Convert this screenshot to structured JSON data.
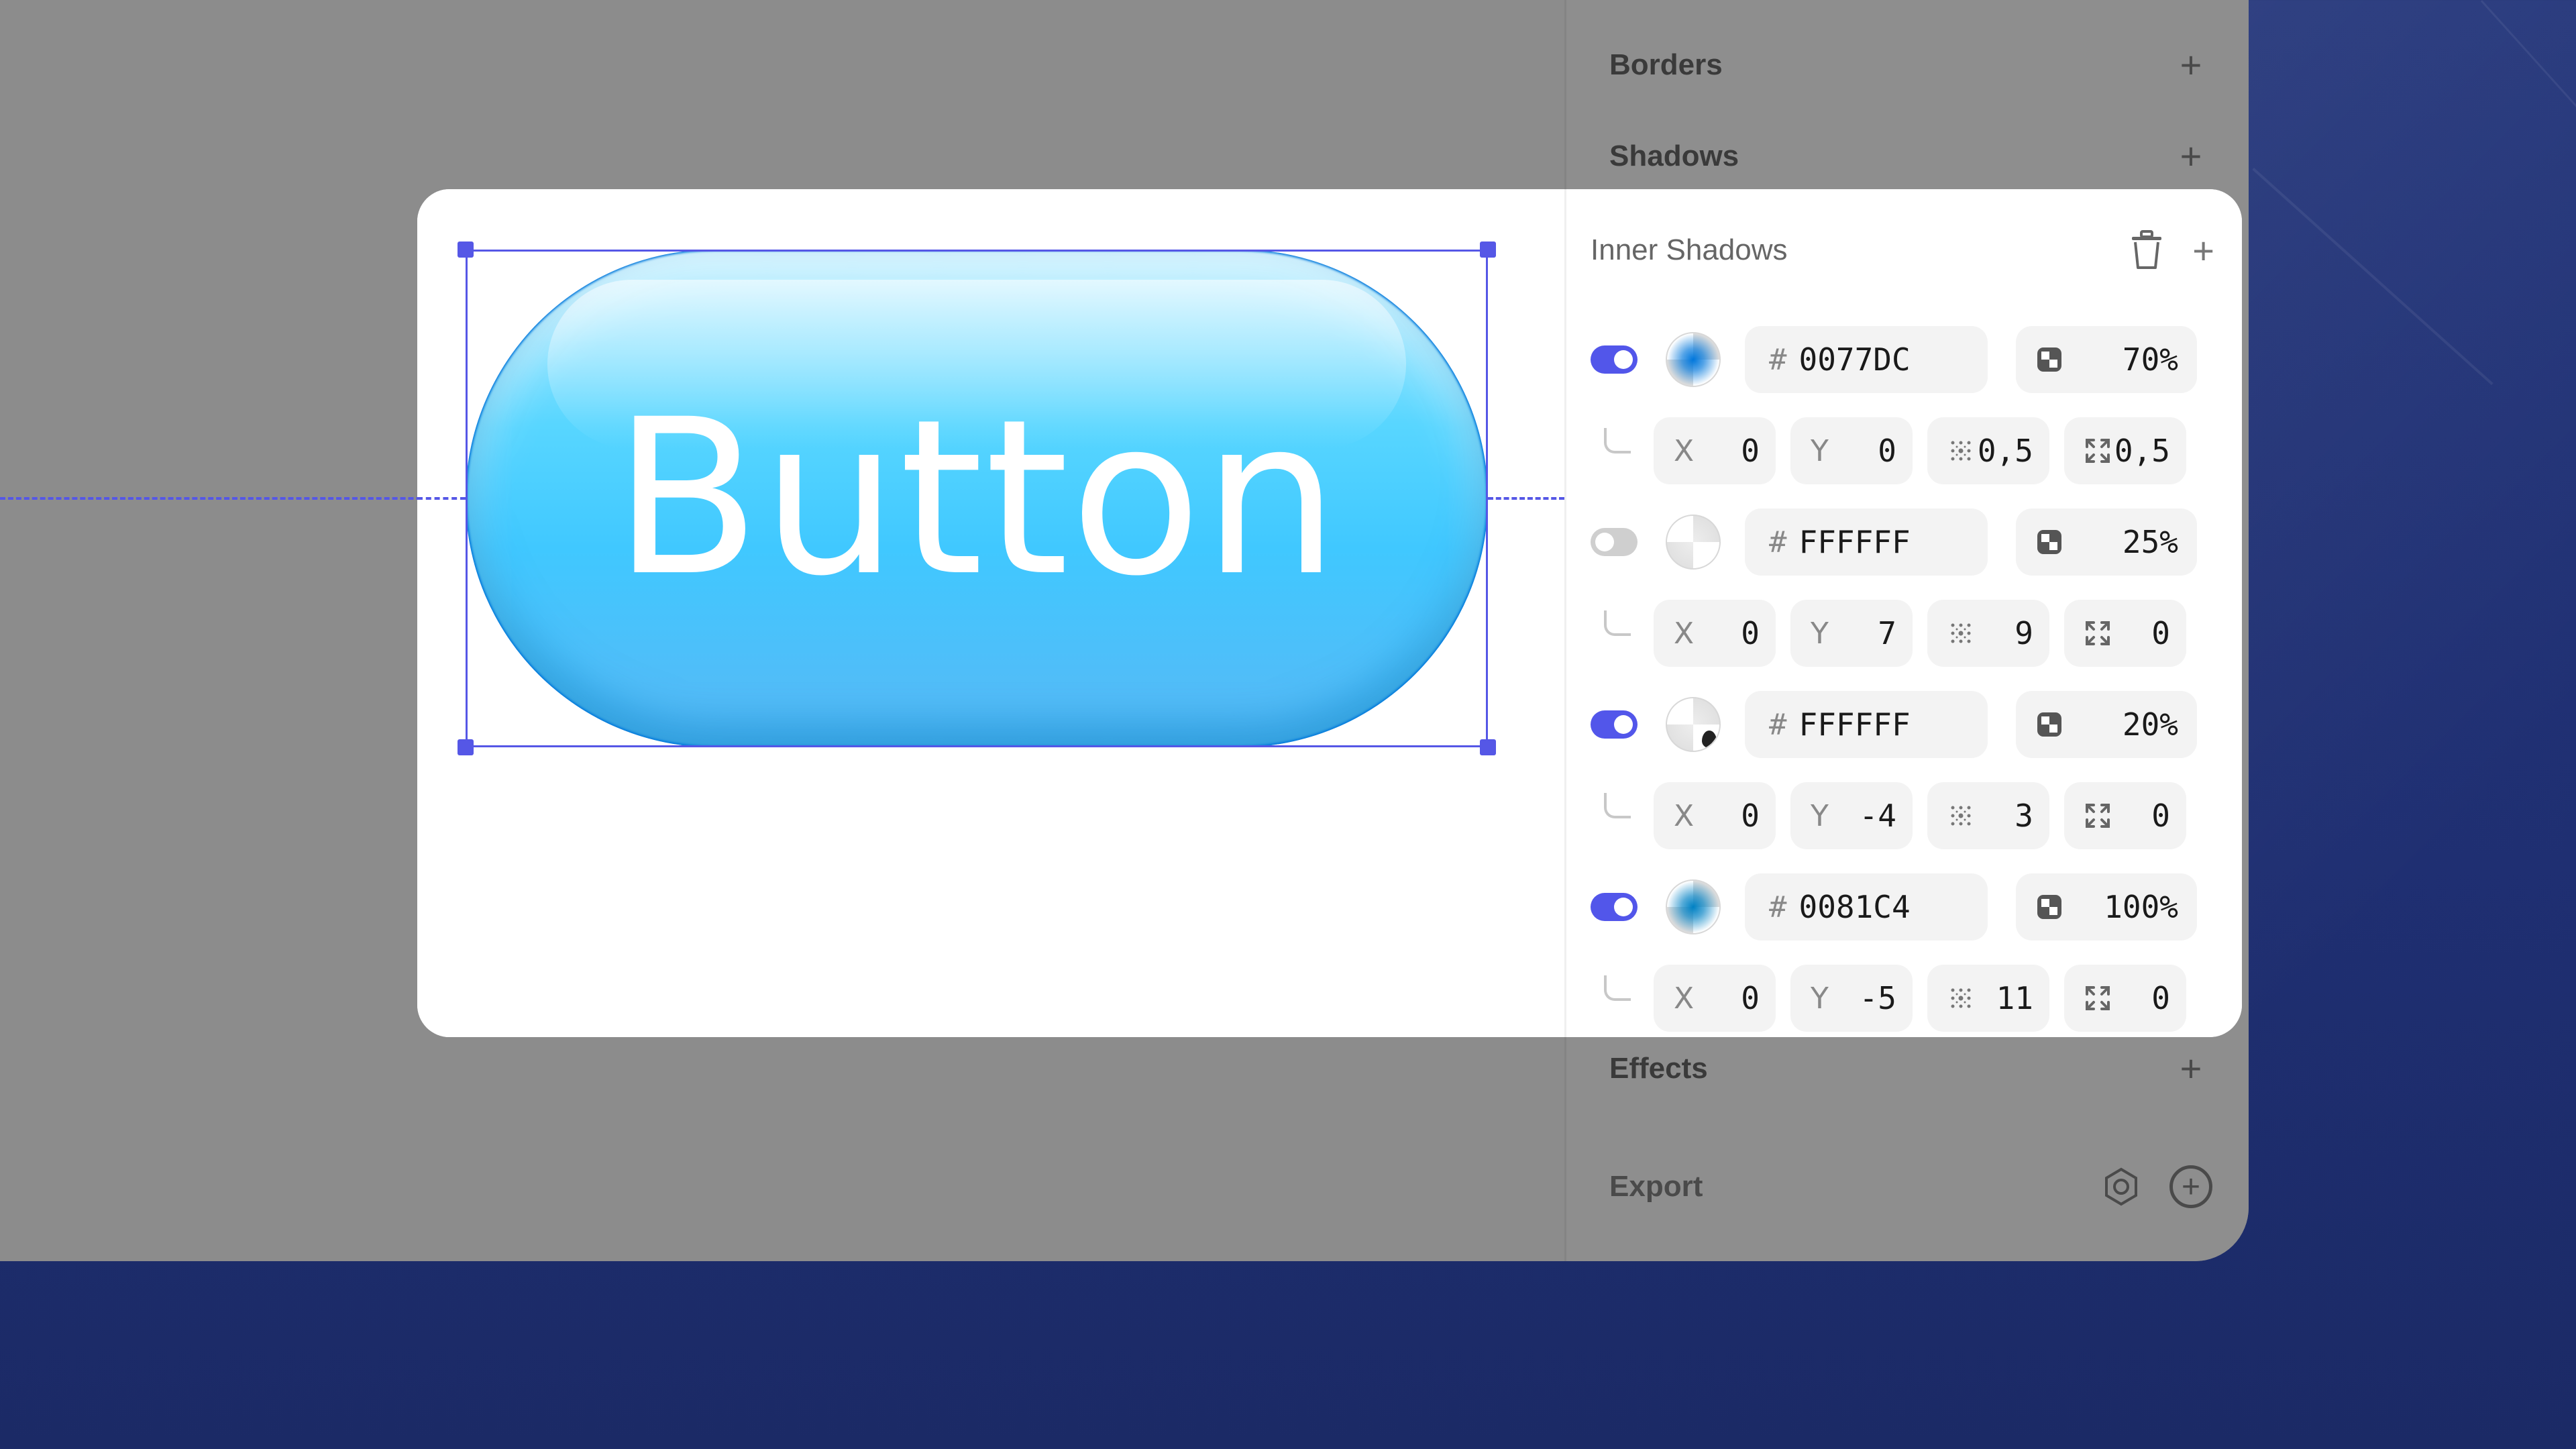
{
  "inspector": {
    "borders_label": "Borders",
    "shadows_label": "Shadows",
    "effects_label": "Effects",
    "export_label": "Export"
  },
  "canvas": {
    "button_text": "Button"
  },
  "inner_shadows": {
    "title": "Inner Shadows",
    "items": [
      {
        "enabled": true,
        "hex": "0077DC",
        "opacity": "70%",
        "x": "0",
        "y": "0",
        "blur": "0,5",
        "spread": "0,5",
        "tint": "#0077DC"
      },
      {
        "enabled": false,
        "hex": "FFFFFF",
        "opacity": "25%",
        "x": "0",
        "y": "7",
        "blur": "9",
        "spread": "0",
        "tint": "#FFFFFF"
      },
      {
        "enabled": true,
        "hex": "FFFFFF",
        "opacity": "20%",
        "x": "0",
        "y": "-4",
        "blur": "3",
        "spread": "0",
        "tint": "#FFFFFF"
      },
      {
        "enabled": true,
        "hex": "0081C4",
        "opacity": "100%",
        "x": "0",
        "y": "-5",
        "blur": "11",
        "spread": "0",
        "tint": "#0081C4"
      }
    ],
    "x_label": "X",
    "y_label": "Y",
    "hash": "#"
  },
  "colors": {
    "accent": "#5256EA",
    "selection": "#5557E6"
  }
}
